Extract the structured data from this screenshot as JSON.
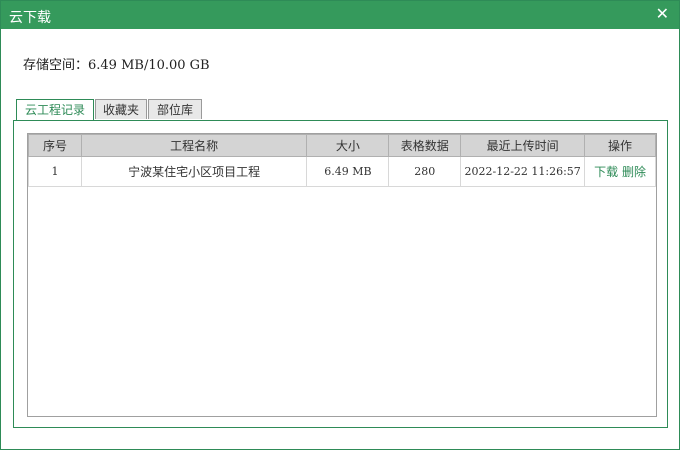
{
  "window": {
    "title": "云下载",
    "close_glyph": "✕"
  },
  "storage": {
    "label": "存储空间：6.49 MB/10.00 GB"
  },
  "tabs": [
    {
      "label": "云工程记录",
      "active": true
    },
    {
      "label": "收藏夹",
      "active": false
    },
    {
      "label": "部位库",
      "active": false
    }
  ],
  "table": {
    "headers": [
      "序号",
      "工程名称",
      "大小",
      "表格数据",
      "最近上传时间",
      "操作"
    ],
    "rows": [
      {
        "index": "1",
        "name": "宁波某住宅小区项目工程",
        "size": "6.49 MB",
        "count": "280",
        "time": "2022-12-22 11:26:57",
        "download": "下载",
        "delete": "删除"
      }
    ]
  },
  "colors": {
    "accent": "#359a5c",
    "header_bg": "#d4d4d4"
  }
}
